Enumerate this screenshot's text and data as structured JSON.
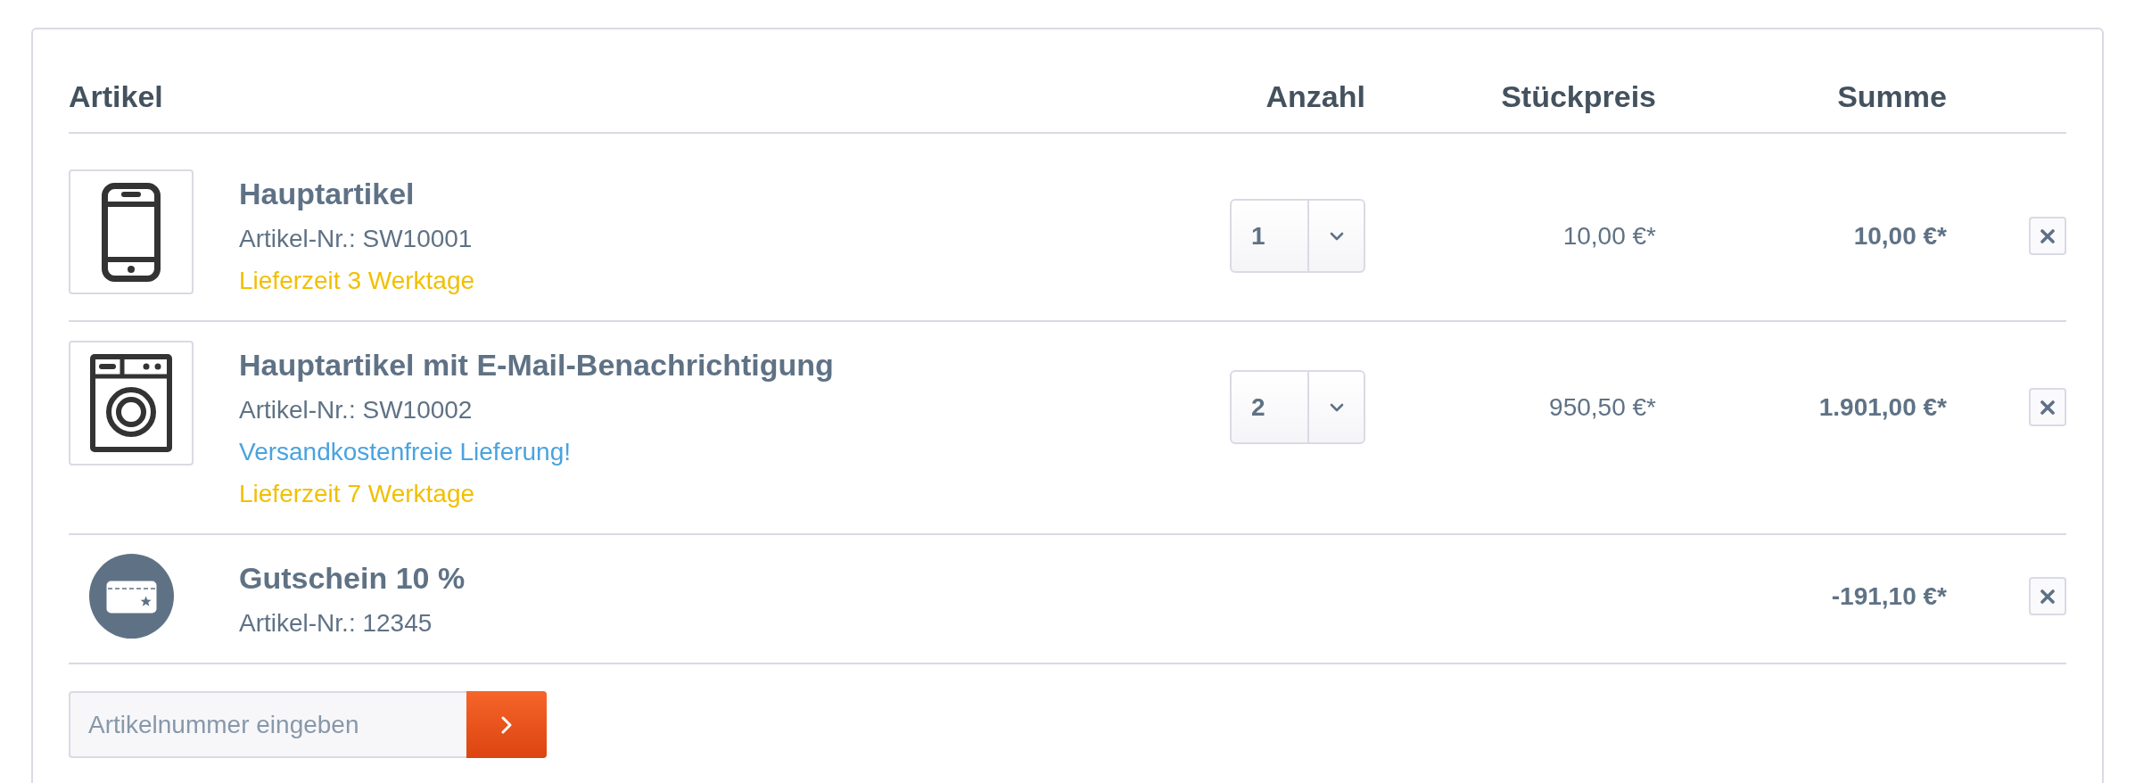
{
  "cart": {
    "columns": [
      "Artikel",
      "Anzahl",
      "Stückpreis",
      "Summe"
    ],
    "rows": [
      {
        "kind": "product",
        "title": "Hauptartikel",
        "number": "Artikel-Nr.: SW10001",
        "notes": [
          {
            "kind": "delivery",
            "text": "Lieferzeit 3 Werktage"
          }
        ],
        "quantity": "1",
        "unit_price": "10,00 €*",
        "total": "10,00 €*"
      },
      {
        "kind": "product",
        "title": "Hauptartikel mit E-Mail-Benachrichtigung",
        "number": "Artikel-Nr.: SW10002",
        "notes": [
          {
            "kind": "shipping",
            "text": "Versandkostenfreie Lieferung!"
          },
          {
            "kind": "delivery",
            "text": "Lieferzeit 7 Werktage"
          }
        ],
        "quantity": "2",
        "unit_price": "950,50 €*",
        "total": "1.901,00 €*"
      },
      {
        "kind": "voucher",
        "title": "Gutschein 10 %",
        "number": "Artikel-Nr.: 12345",
        "total": "-191,10 €*"
      }
    ]
  },
  "add_article": {
    "placeholder": "Artikelnummer eingeben"
  }
}
